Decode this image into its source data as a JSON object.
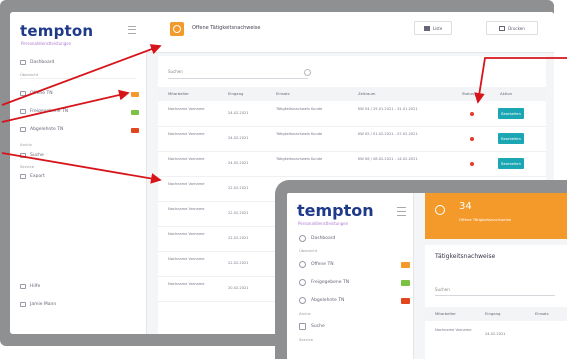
{
  "sidebar": {
    "logo": "tempton",
    "tagline": "Personaldienstleistungen",
    "items": [
      {
        "label": "Dashboard",
        "badge_color": ""
      },
      {
        "label": "Offene TN",
        "badge_color": "#f39a2a"
      },
      {
        "label": "Freigegebene TN",
        "badge_color": "#7cc242"
      },
      {
        "label": "Abgelehnte TN",
        "badge_color": "#e2461f"
      },
      {
        "label": "Suche",
        "badge_color": ""
      },
      {
        "label": "Export",
        "badge_color": ""
      }
    ],
    "section_overview": "Übersicht",
    "section_archive": "Archiv",
    "section_service": "Service",
    "footer_items": [
      {
        "label": "Hilfe"
      },
      {
        "label": "Jamie Mann"
      }
    ]
  },
  "topbar": {
    "title": "Offene Tätigkeitsnachweise",
    "button_save": "Liste",
    "button_print": "Drucken"
  },
  "table": {
    "search_placeholder": "Suchen",
    "columns": [
      "Mitarbeiter",
      "Eingang",
      "Einsatz",
      "Zeitraum",
      "Status",
      "Aktion"
    ],
    "rows": [
      {
        "name": "Nachname Vorname",
        "date": "24.02.2021",
        "assignment": "Tätigkeitsnachweis Kunde",
        "period": "KW 04 / 25.01.2021 - 31.01.2021",
        "action": "Bearbeiten"
      },
      {
        "name": "Nachname Vorname",
        "date": "24.02.2021",
        "assignment": "Tätigkeitsnachweis Kunde",
        "period": "KW 05 / 01.02.2021 - 07.02.2021",
        "action": "Bearbeiten"
      },
      {
        "name": "Nachname Vorname",
        "date": "24.02.2021",
        "assignment": "Tätigkeitsnachweis Kunde",
        "period": "KW 06 / 08.02.2021 - 14.02.2021",
        "action": "Bearbeiten"
      },
      {
        "name": "Nachname Vorname",
        "date": "22.02.2021",
        "assignment": "",
        "period": "",
        "action": ""
      },
      {
        "name": "Nachname Vorname",
        "date": "22.02.2021",
        "assignment": "",
        "period": "",
        "action": ""
      },
      {
        "name": "Nachname Vorname",
        "date": "22.02.2021",
        "assignment": "",
        "period": "",
        "action": ""
      },
      {
        "name": "Nachname Vorname",
        "date": "22.02.2021",
        "assignment": "",
        "period": "",
        "action": ""
      },
      {
        "name": "Nachname Vorname",
        "date": "20.02.2021",
        "assignment": "",
        "period": "",
        "action": ""
      }
    ]
  },
  "inset": {
    "logo": "tempton",
    "tagline": "Personaldienstleistungen",
    "items": [
      {
        "label": "Dashboard"
      },
      {
        "label": "Offene TN"
      },
      {
        "label": "Freigegebene TN"
      },
      {
        "label": "Abgelehnte TN"
      },
      {
        "label": "Suche"
      }
    ],
    "section_overview": "Übersicht",
    "section_archive": "Archiv",
    "section_service": "Service",
    "stat_number": "34",
    "stat_label": "Offene Tätigkeitsnachweise",
    "card_title": "Tätigkeitsnachweise",
    "search_placeholder": "Suchen",
    "columns": [
      "Mitarbeiter",
      "Eingang",
      "Einsatz"
    ],
    "row_name": "Nachname Vorname",
    "row_date": "24.02.2021"
  },
  "colors": {
    "arrow": "#d7141a",
    "accent": "#f39a2a",
    "teal": "#1aa6b3",
    "status_dot": "#e23b2e"
  }
}
